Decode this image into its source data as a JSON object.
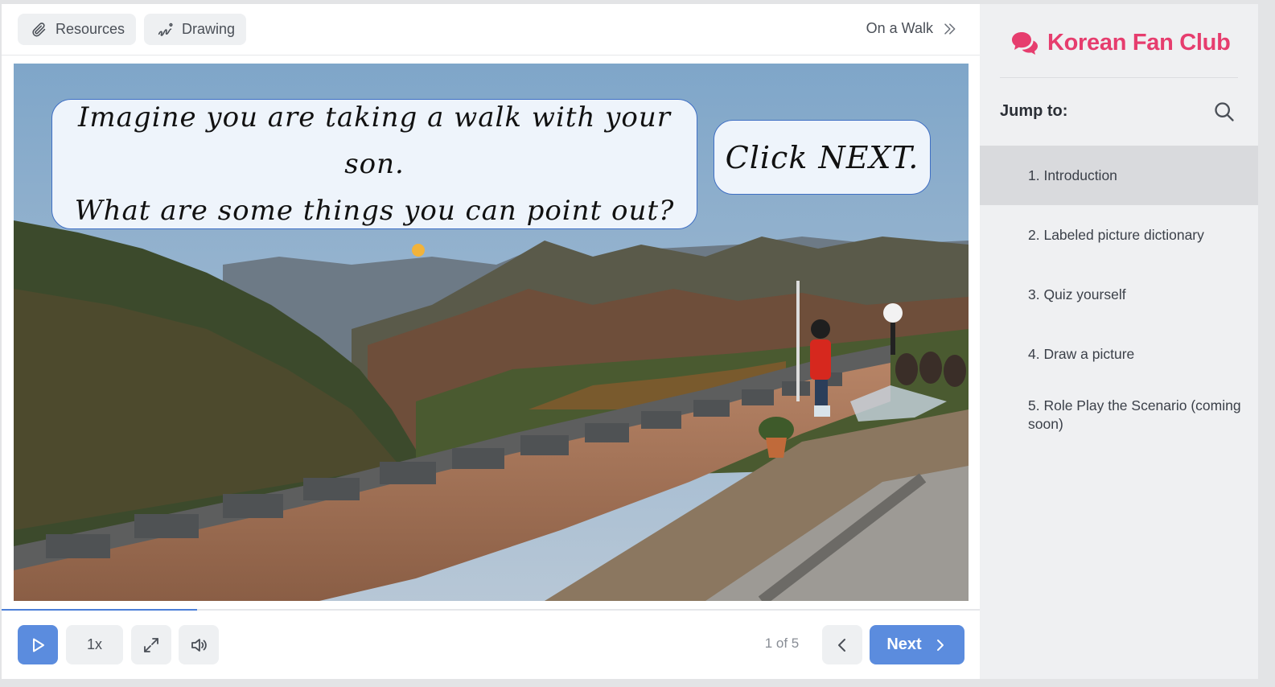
{
  "toolbar": {
    "resources_label": "Resources",
    "drawing_label": "Drawing",
    "next_lesson_label": "On a Walk"
  },
  "slide": {
    "caption_line1": "Imagine you are taking a walk with your son.",
    "caption_line2": "What are some things you can point out?",
    "caption_next": "Click NEXT."
  },
  "progress": {
    "fraction": 0.2
  },
  "controls": {
    "speed_label": "1x",
    "page_indicator": "1 of 5",
    "next_label": "Next"
  },
  "sidebar": {
    "brand_name": "Korean Fan Club",
    "jump_label": "Jump to:",
    "items": [
      {
        "label": "1. Introduction",
        "active": true
      },
      {
        "label": "2. Labeled picture dictionary",
        "active": false
      },
      {
        "label": "3. Quiz yourself",
        "active": false
      },
      {
        "label": "4. Draw a picture",
        "active": false
      },
      {
        "label": "5. Role Play the Scenario (coming soon)",
        "active": false
      }
    ]
  },
  "colors": {
    "accent": "#5b8cde",
    "brand": "#e63d6e",
    "sidebar_bg": "#eff0f2"
  },
  "icons": [
    "paperclip-icon",
    "squiggle-icon",
    "double-chevron-right-icon",
    "play-icon",
    "expand-icon",
    "speaker-icon",
    "chevron-left-icon",
    "chevron-right-icon",
    "chat-bubbles-icon",
    "search-icon"
  ]
}
